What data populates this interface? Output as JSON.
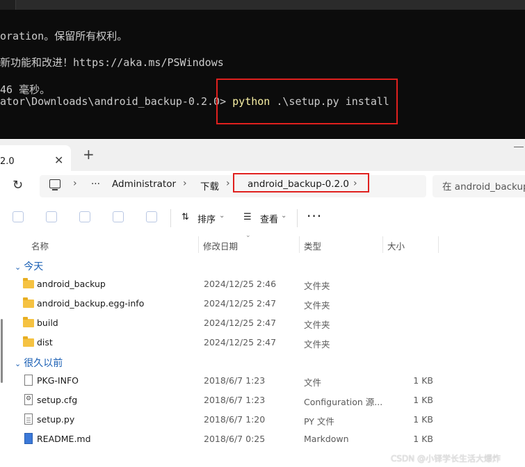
{
  "terminal": {
    "lines": [
      "oration。保留所有权利。",
      "和改进！https://aka.ms/PSWindows",
      "46 毫秒。",
      "ator\\Downloads\\android_backup-0.2.0> "
    ],
    "line2_prefix": "新功能",
    "cmd_python": "python",
    "cmd_rest": " .\\setup.py install"
  },
  "explorer": {
    "tab_title": "2.0",
    "tab_close": "✕",
    "tab_new": "+",
    "more_crumbs": "···",
    "crumbs": [
      "Administrator",
      "下载",
      "android_backup-0.2.0"
    ],
    "search_placeholder": "在 android_backup",
    "toolbar": {
      "sort_label": "排序",
      "view_label": "查看",
      "more_label": "···"
    },
    "columns": [
      "名称",
      "修改日期",
      "类型",
      "大小"
    ],
    "groups": [
      {
        "label": "今天",
        "items": [
          {
            "name": "android_backup",
            "date": "2024/12/25 2:46",
            "type": "文件夹",
            "size": "",
            "icon": "folder-icon"
          },
          {
            "name": "android_backup.egg-info",
            "date": "2024/12/25 2:47",
            "type": "文件夹",
            "size": "",
            "icon": "folder-icon"
          },
          {
            "name": "build",
            "date": "2024/12/25 2:47",
            "type": "文件夹",
            "size": "",
            "icon": "folder-icon"
          },
          {
            "name": "dist",
            "date": "2024/12/25 2:47",
            "type": "文件夹",
            "size": "",
            "icon": "folder-icon"
          }
        ]
      },
      {
        "label": "很久以前",
        "items": [
          {
            "name": "PKG-INFO",
            "date": "2018/6/7 1:23",
            "type": "文件",
            "size": "1 KB",
            "icon": "file-icon"
          },
          {
            "name": "setup.cfg",
            "date": "2018/6/7 1:23",
            "type": "Configuration 源...",
            "size": "1 KB",
            "icon": "config-file-icon"
          },
          {
            "name": "setup.py",
            "date": "2018/6/7 1:20",
            "type": "PY 文件",
            "size": "1 KB",
            "icon": "python-file-icon"
          },
          {
            "name": "README.md",
            "date": "2018/6/7 0:25",
            "type": "Markdown",
            "size": "1 KB",
            "icon": "markdown-file-icon"
          }
        ]
      }
    ]
  },
  "watermark": "CSDN @小铎学长生活大爆炸",
  "colors": {
    "terminal_bg": "#0c0c0c",
    "terminal_text": "#cccccc",
    "command_highlight": "#f9f1a5",
    "highlight_box": "#e0201e",
    "folder": "#f5c242",
    "group_header": "#1a5fb4"
  }
}
